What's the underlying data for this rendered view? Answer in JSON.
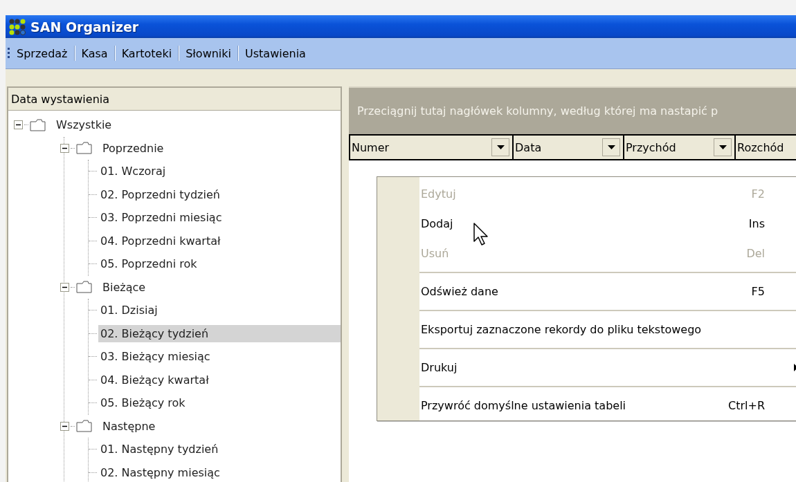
{
  "window": {
    "title": "SAN Organizer"
  },
  "menu_bar": [
    {
      "label": "Sprzedaż"
    },
    {
      "label": "Kasa"
    },
    {
      "label": "Kartoteki"
    },
    {
      "label": "Słowniki"
    },
    {
      "label": "Ustawienia"
    }
  ],
  "tree": {
    "header": "Data wystawienia",
    "nodes": [
      {
        "label": "Wszystkie",
        "expanded": true,
        "selected": false,
        "children": [
          {
            "label": "Poprzednie",
            "expanded": true,
            "selected": false,
            "children": [
              {
                "label": "01. Wczoraj",
                "selected": false
              },
              {
                "label": "02. Poprzedni tydzień",
                "selected": false
              },
              {
                "label": "03. Poprzedni miesiąc",
                "selected": false
              },
              {
                "label": "04. Poprzedni kwartał",
                "selected": false
              },
              {
                "label": "05. Poprzedni rok",
                "selected": false
              }
            ]
          },
          {
            "label": "Bieżące",
            "expanded": true,
            "selected": false,
            "children": [
              {
                "label": "01. Dzisiaj",
                "selected": false
              },
              {
                "label": "02. Bieżący tydzień",
                "selected": true
              },
              {
                "label": "03. Bieżący miesiąc",
                "selected": false
              },
              {
                "label": "04. Bieżący kwartał",
                "selected": false
              },
              {
                "label": "05. Bieżący rok",
                "selected": false
              }
            ]
          },
          {
            "label": "Następne",
            "expanded": true,
            "selected": false,
            "children": [
              {
                "label": "01. Następny tydzień",
                "selected": false
              },
              {
                "label": "02. Następny miesiąc",
                "selected": false
              }
            ]
          }
        ]
      }
    ]
  },
  "grid": {
    "group_hint": "Przeciągnij tutaj nagłówek kolumny, według której ma nastapić p",
    "columns": [
      {
        "label": "Numer"
      },
      {
        "label": "Data"
      },
      {
        "label": "Przychód"
      },
      {
        "label": "Rozchód"
      }
    ]
  },
  "context_menu": [
    {
      "kind": "item",
      "label": "Edytuj",
      "shortcut": "F2",
      "disabled": true
    },
    {
      "kind": "item",
      "label": "Dodaj",
      "shortcut": "Ins",
      "disabled": false
    },
    {
      "kind": "item",
      "label": "Usuń",
      "shortcut": "Del",
      "disabled": true
    },
    {
      "kind": "separator"
    },
    {
      "kind": "item",
      "label": "Odśwież dane",
      "shortcut": "F5",
      "disabled": false
    },
    {
      "kind": "separator"
    },
    {
      "kind": "item",
      "label": "Eksportuj zaznaczone rekordy do pliku tekstowego",
      "disabled": false
    },
    {
      "kind": "separator"
    },
    {
      "kind": "submenu",
      "label": "Drukuj",
      "disabled": false
    },
    {
      "kind": "separator"
    },
    {
      "kind": "item",
      "label": "Przywróć domyślne ustawienia tabeli",
      "shortcut": "Ctrl+R",
      "disabled": false
    }
  ]
}
